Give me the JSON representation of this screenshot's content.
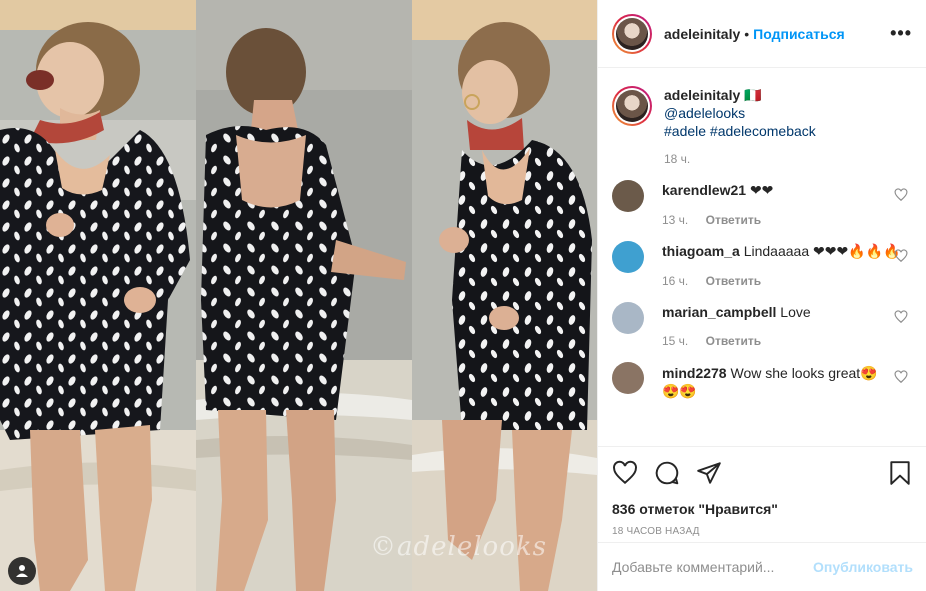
{
  "post": {
    "username": "adeleinitaly",
    "follow_label": "Подписаться",
    "more_label": "•••",
    "separator": "•"
  },
  "caption": {
    "username": "adeleinitaly",
    "emoji": "🇮🇹",
    "mention": "@adelelooks",
    "hashtags": "#adele #adelecomeback",
    "time": "18 ч."
  },
  "comments": [
    {
      "user": "karendlew21",
      "text": "❤❤",
      "time": "13 ч.",
      "reply": "Ответить",
      "avatar_color": "#6b5a4a"
    },
    {
      "user": "thiagoam_a",
      "text": "Lindaaaaa ❤❤❤🔥🔥🔥",
      "time": "16 ч.",
      "reply": "Ответить",
      "avatar_color": "#3fa0d0"
    },
    {
      "user": "marian_campbell",
      "text": "Love",
      "time": "15 ч.",
      "reply": "Ответить",
      "avatar_color": "#a9b7c6"
    },
    {
      "user": "mind2278",
      "text": "Wow she looks great😍😍😍",
      "time": "",
      "reply": "",
      "avatar_color": "#8a7464"
    }
  ],
  "actions": {
    "likes": "836 отметок \"Нравится\"",
    "time": "18 ЧАСОВ НАЗАД"
  },
  "add_comment": {
    "placeholder": "Добавьте комментарий...",
    "publish_label": "Опубликовать"
  },
  "photo": {
    "watermark": "©adelelooks"
  },
  "colors": {
    "accent": "#0095f6",
    "publish_disabled": "#b2dffc",
    "muted": "#8e8e8e"
  }
}
